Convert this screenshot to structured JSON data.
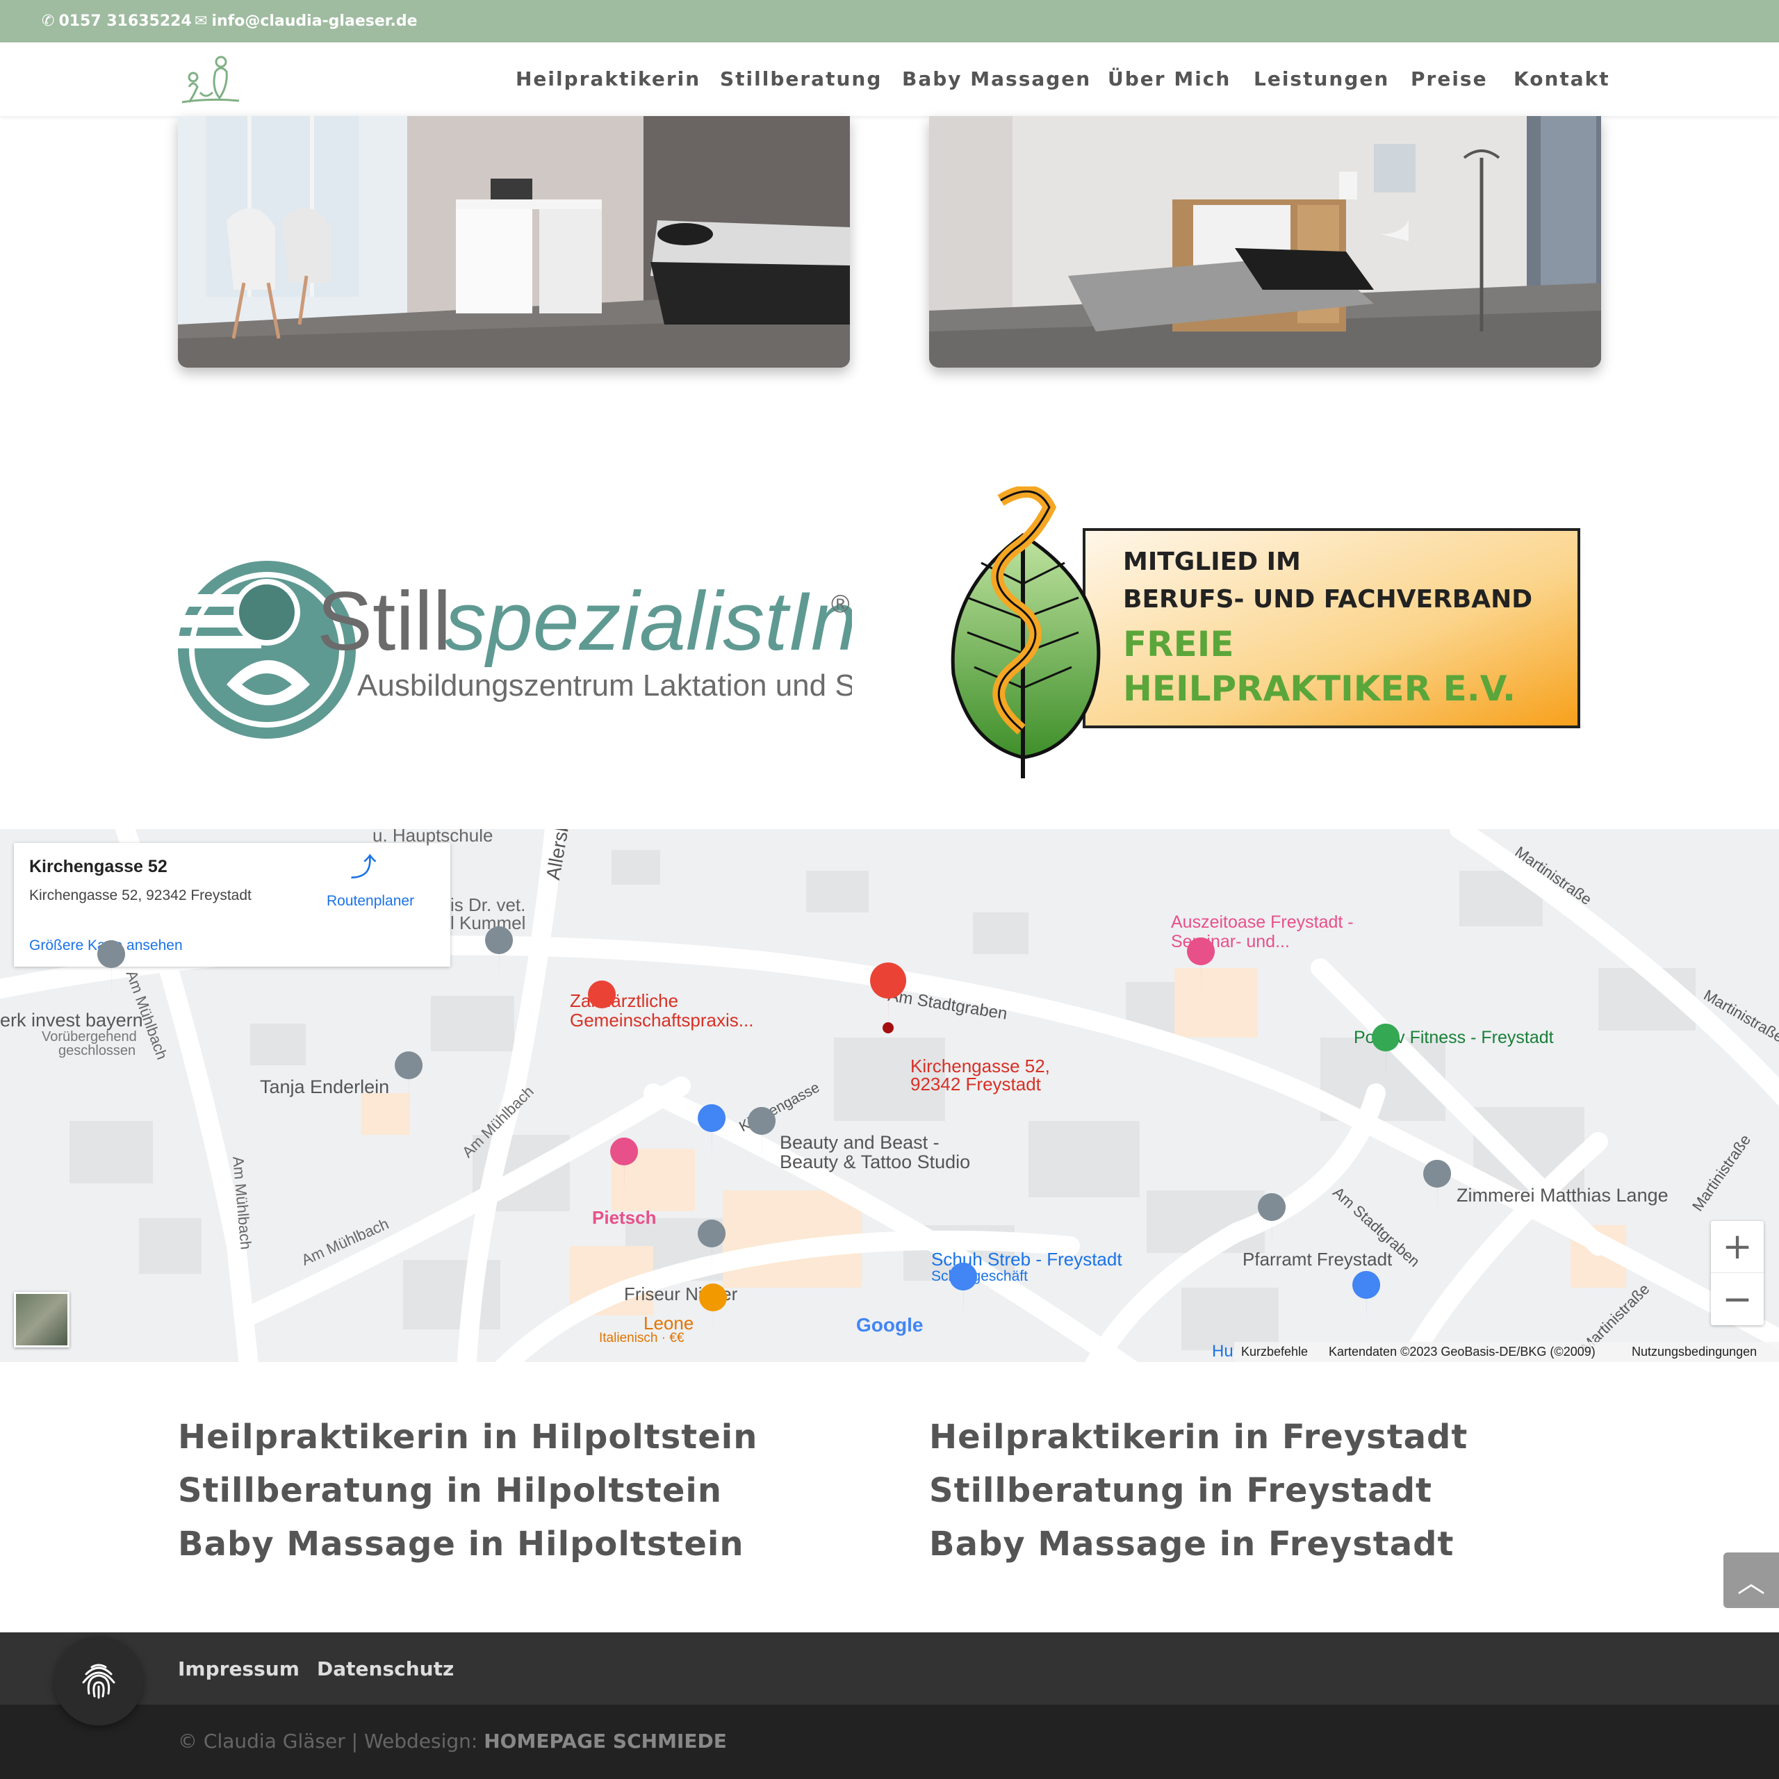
{
  "topbar": {
    "phone": "0157 31635224",
    "email": "info@claudia-glaeser.de"
  },
  "nav": {
    "items": [
      {
        "label": "Heilpraktikerin"
      },
      {
        "label": "Stillberatung"
      },
      {
        "label": "Baby Massagen"
      },
      {
        "label": "Über Mich"
      },
      {
        "label": "Leistungen"
      },
      {
        "label": "Preise"
      },
      {
        "label": "Kontakt"
      }
    ]
  },
  "badges": {
    "still": {
      "word1": "Still",
      "word2": "spezialistIn",
      "reg": "®",
      "sub": "Ausbildungszentrum Laktation und Stillen"
    },
    "verband": {
      "line1": "MITGLIED IM",
      "line2": "BERUFS- UND FACHVERBAND",
      "line3": "FREIE",
      "line4": "HEILPRAKTIKER E.V."
    }
  },
  "map": {
    "card_title": "Kirchengasse 52",
    "card_address": "Kirchengasse 52, 92342 Freystadt",
    "route_label": "Routenplaner",
    "bigger_map": "Größere Karte ansehen",
    "marker_line1": "Kirchengasse 52,",
    "marker_line2": "92342 Freystadt",
    "places": {
      "hauptschule": "u. Hauptschule",
      "drvet1": "is Dr. vet.",
      "drvet2": "l Kummel",
      "allersberg": "Allersberg",
      "invest": "erk invest bayern",
      "invest_sub1": "Vorübergehend",
      "invest_sub2": "geschlossen",
      "muehlbach": "Am Mühlbach",
      "zahn1": "Zahnärztliche",
      "zahn2": "Gemeinschaftspraxis...",
      "stadtgraben": "Am Stadtgraben",
      "auszeit1": "Auszeitoase Freystadt -",
      "auszeit2": "Seminar- und...",
      "martini": "Martinistraße",
      "positiv": "Positiv Fitness - Freystadt",
      "tanja": "Tanja Enderlein",
      "kirchengasse": "Kirchengasse",
      "beauty1": "Beauty and Beast -",
      "beauty2": "Beauty & Tattoo Studio",
      "pietsch": "Pietsch",
      "zimmerei": "Zimmerei Matthias Lange",
      "pfarramt": "Pfarramt Freystadt",
      "schuh1": "Schuh Streb - Freystadt",
      "schuh2": "Schuhgeschäft",
      "friseur": "Friseur Nieser",
      "leone": "Leone",
      "leone_sub": "Italienisch · €€",
      "google": "Google",
      "hu": "Hu"
    },
    "attribution": {
      "shortcuts": "Kurzbefehle",
      "data": "Kartendaten ©2023 GeoBasis-DE/BKG (©2009)",
      "terms": "Nutzungsbedingungen"
    },
    "zoom_in": "+",
    "zoom_out": "−"
  },
  "links": {
    "left": [
      "Heilpraktikerin in Hilpoltstein",
      "Stillberatung in Hilpoltstein",
      "Baby Massage in Hilpoltstein"
    ],
    "right": [
      "Heilpraktikerin in Freystadt",
      "Stillberatung in Freystadt",
      "Baby Massage in Freystadt"
    ]
  },
  "footer": {
    "impressum": "Impressum",
    "datenschutz": "Datenschutz",
    "copyright": "© Claudia Gläser | Webdesign: ",
    "designer": "HOMEPAGE SCHMIEDE"
  },
  "colors": {
    "topbar": "#9fbba0",
    "teal": "#5f9a92",
    "leaf_green": "#5aa63a",
    "orange": "#f7a01a"
  }
}
